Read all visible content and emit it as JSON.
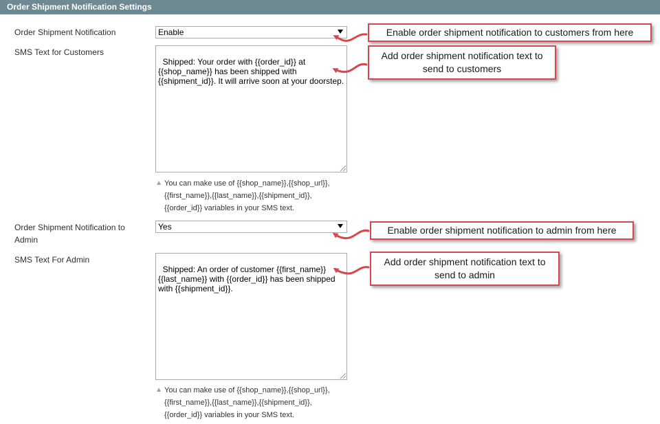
{
  "section": {
    "title": "Order Shipment Notification Settings"
  },
  "fields": {
    "customer_notification": {
      "label": "Order Shipment Notification",
      "value": "Enable"
    },
    "customer_text": {
      "label": "SMS Text for Customers",
      "value": "Shipped: Your order with {{order_id}} at\n{{shop_name}} has been shipped with\n{{shipment_id}}. It will arrive soon at your doorstep.",
      "note_lines": [
        "You can make use of {{shop_name}},{{shop_url}},",
        "{{first_name}},{{last_name}},{{shipment_id}},",
        "{{order_id}} variables in your SMS text."
      ]
    },
    "admin_notification": {
      "label_line1": "Order Shipment Notification to",
      "label_line2": "Admin",
      "value": "Yes"
    },
    "admin_text": {
      "label": "SMS Text For Admin",
      "value": "Shipped: An order of customer {{first_name}}\n{{last_name}} with {{order_id}} has been shipped\nwith {{shipment_id}}.",
      "note_lines": [
        "You can make use of {{shop_name}},{{shop_url}},",
        "{{first_name}},{{last_name}},{{shipment_id}},",
        "{{order_id}} variables in your SMS text."
      ]
    }
  },
  "callouts": {
    "c1": "Enable order shipment notification to customers from here",
    "c2_line1": "Add order shipment notification text to",
    "c2_line2": "send to customers",
    "c3": "Enable order shipment notification to admin from here",
    "c4_line1": "Add order shipment notification text to",
    "c4_line2": "send to admin"
  },
  "colors": {
    "header_bg": "#6f8992",
    "callout_border": "#d9464f",
    "arrow": "#d9464f"
  },
  "icons": {
    "dropdown": "triangle-down-icon",
    "note": "triangle-up-icon",
    "resize": "resize-grip-icon"
  }
}
